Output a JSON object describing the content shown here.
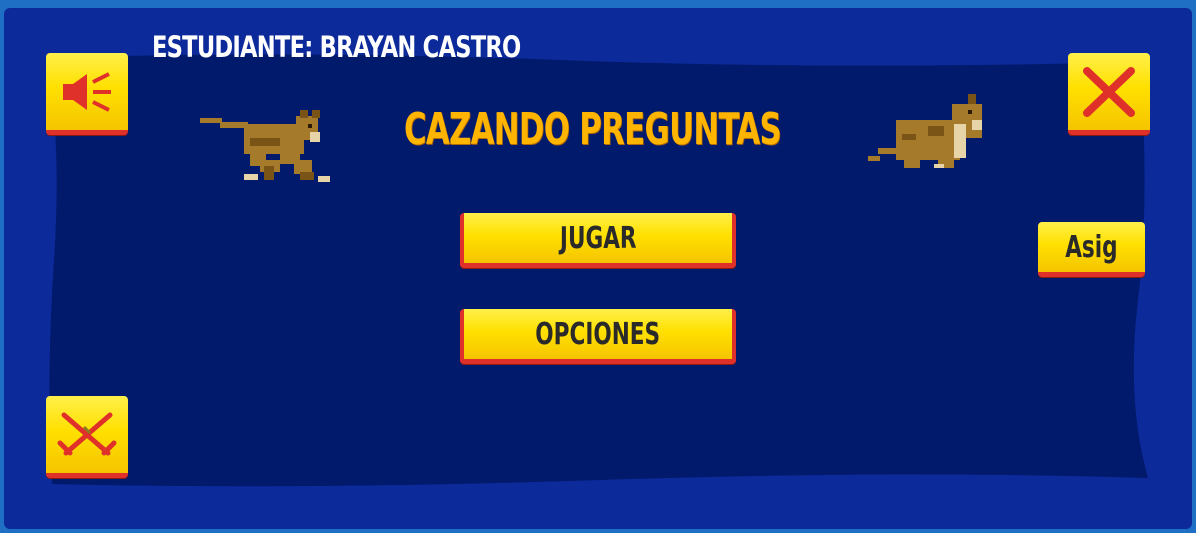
{
  "header": {
    "student": "ESTUDIANTE: BRAYAN CASTRO",
    "title": "CAZANDO PREGUNTAS"
  },
  "menu": {
    "play_label": "JUGAR",
    "options_label": "OPCIONES"
  },
  "side": {
    "asig_label": "Asig"
  },
  "icons": {
    "sound": "speaker-icon",
    "close": "close-icon",
    "battle": "crossed-swords-icon"
  },
  "colors": {
    "background": "#0c2a9a",
    "panel": "#001a6a",
    "title": "#ffb400",
    "button": "#ffe000",
    "button_border": "#e0302a",
    "icon_red": "#e0302a"
  }
}
